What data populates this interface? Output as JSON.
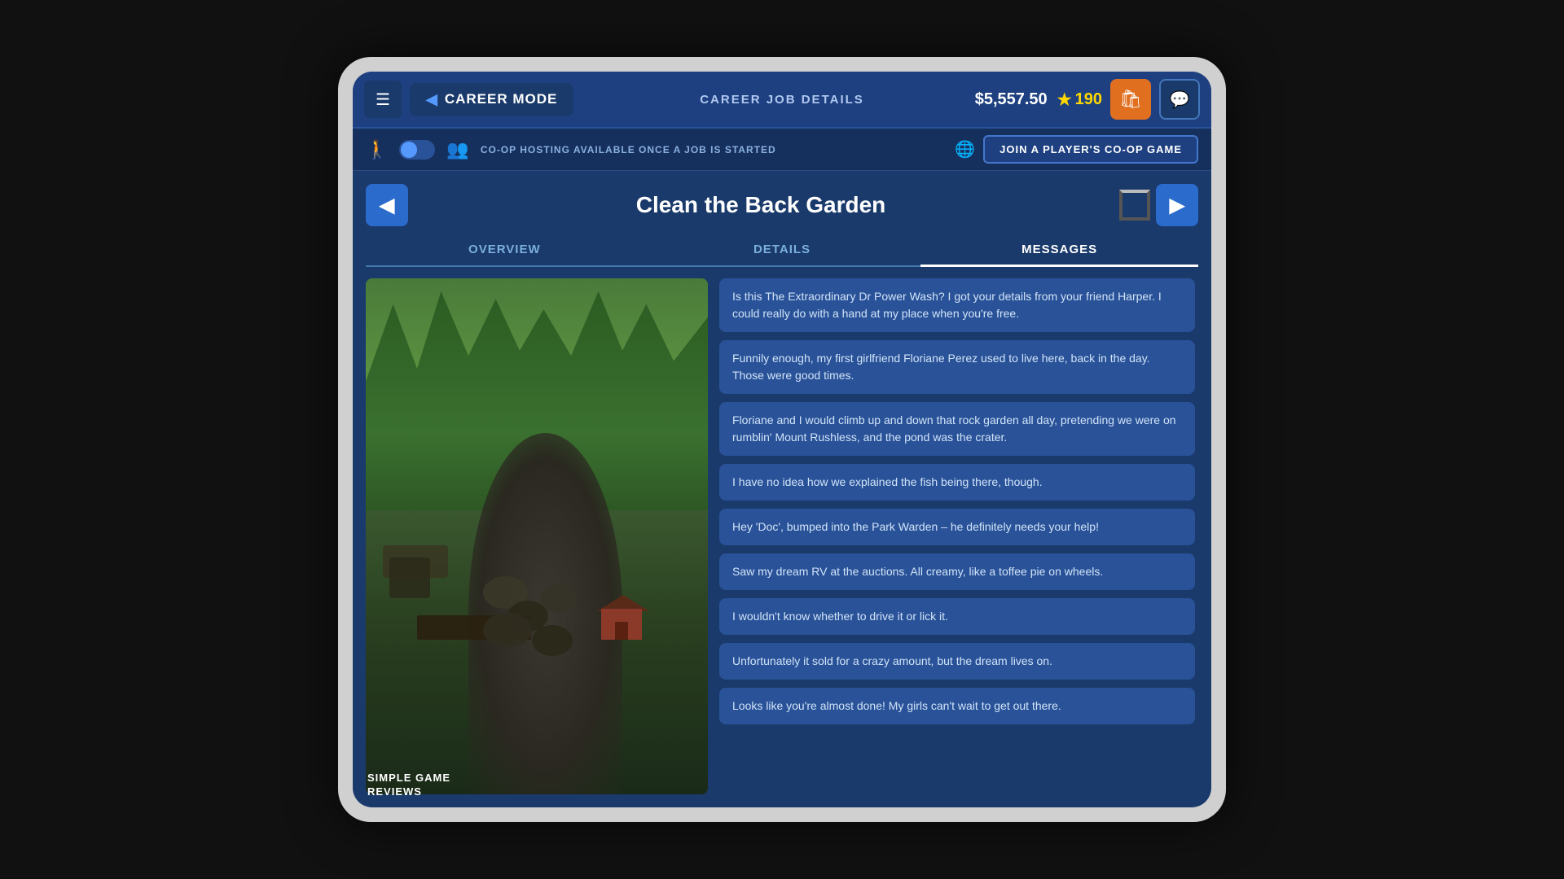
{
  "header": {
    "menu_label": "☰",
    "back_arrow": "◀",
    "career_mode_label": "CAREER MODE",
    "page_title": "CAREER JOB DETAILS",
    "money": "$5,557.50",
    "stars": "190",
    "shop_icon": "🛍",
    "message_icon": "💬"
  },
  "coop": {
    "text": "CO-OP HOSTING AVAILABLE ONCE A JOB IS STARTED",
    "join_label": "JOIN A PLAYER'S CO-OP GAME"
  },
  "job": {
    "title": "Clean the Back Garden",
    "prev_arrow": "◀",
    "next_arrow": "▶"
  },
  "tabs": [
    {
      "label": "OVERVIEW",
      "active": false
    },
    {
      "label": "DETAILS",
      "active": false
    },
    {
      "label": "MESSAGES",
      "active": true
    }
  ],
  "messages": [
    {
      "text": "Is this The Extraordinary Dr Power Wash? I got your details from your friend Harper. I could really do with a hand at my place when you're free."
    },
    {
      "text": "Funnily enough, my first girlfriend Floriane Perez used to live here, back in the day. Those were good times."
    },
    {
      "text": "Floriane and I would climb up and down that rock garden all day, pretending we were on rumblin' Mount Rushless, and the pond was the crater."
    },
    {
      "text": "I have no idea how we explained the fish being there, though."
    },
    {
      "text": "Hey 'Doc', bumped into the Park Warden – he definitely needs your help!"
    },
    {
      "text": "Saw my dream RV at the auctions. All creamy, like a toffee pie on wheels."
    },
    {
      "text": "I wouldn't know whether to drive it or lick it."
    },
    {
      "text": "Unfortunately it sold for a crazy amount, but the dream lives on."
    },
    {
      "text": "Looks like you're almost done! My girls can't wait to get out there."
    }
  ],
  "watermark": {
    "line1": "SIMPLE GAME",
    "line2": "REVIEWS"
  }
}
